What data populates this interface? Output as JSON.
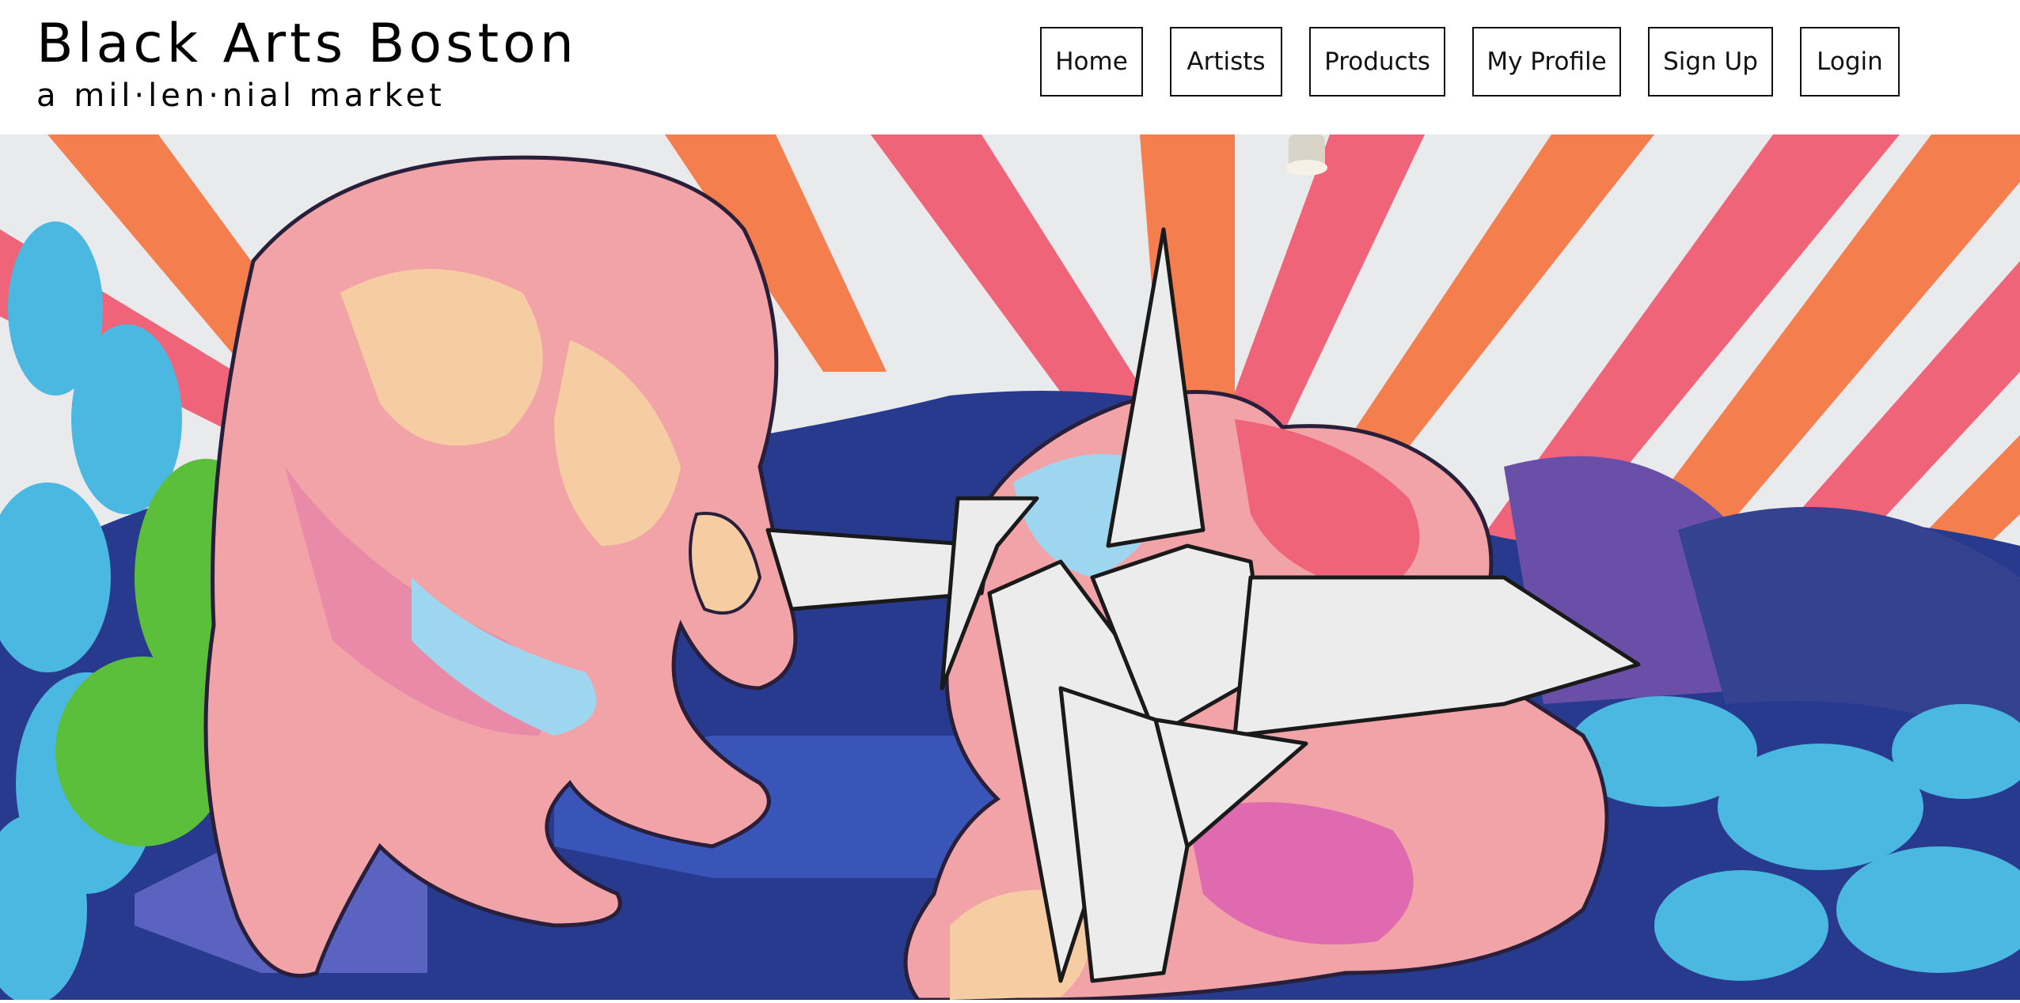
{
  "site": {
    "title": "Black Arts Boston",
    "tagline": "a mil·len·nial market"
  },
  "nav": {
    "items": [
      {
        "label": "Home",
        "name": "nav-home"
      },
      {
        "label": "Artists",
        "name": "nav-artists"
      },
      {
        "label": "Products",
        "name": "nav-products"
      },
      {
        "label": "My Profile",
        "name": "nav-my-profile"
      },
      {
        "label": "Sign Up",
        "name": "nav-sign-up"
      },
      {
        "label": "Login",
        "name": "nav-login"
      }
    ]
  },
  "hero": {
    "image": "mural-hands-paper-crane",
    "colors": {
      "stripe_orange": "#f47e4e",
      "stripe_pink": "#f0647a",
      "wall_white": "#e9eaec",
      "navy": "#283a8e",
      "purple": "#6a4fa8",
      "sky_blue": "#4ab8e0",
      "green": "#5cbf3c",
      "skin_pink": "#f2a3a8",
      "skin_peach": "#f6cda2"
    }
  }
}
